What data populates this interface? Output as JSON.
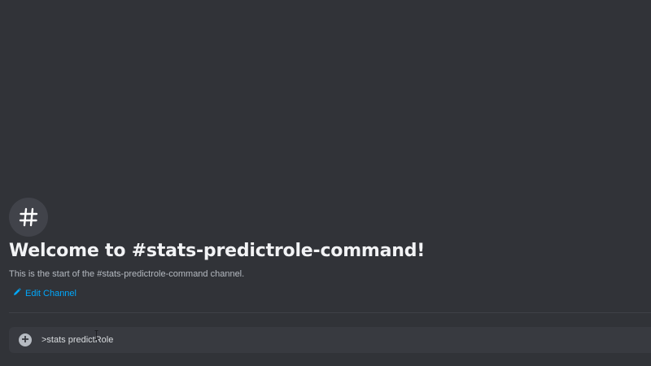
{
  "channel": {
    "name": "stats-predictrole-command",
    "icon": "hashtag-icon"
  },
  "welcome": {
    "title": "Welcome to #stats-predictrole-command!",
    "subtitle": "This is the start of the #stats-predictrole-command channel."
  },
  "actions": {
    "edit_channel_label": "Edit Channel",
    "edit_icon": "pencil-icon"
  },
  "composer": {
    "value": ">stats predictRole",
    "attach_icon": "plus-circle-icon"
  },
  "colors": {
    "background": "#313338",
    "composer_background": "#383a40",
    "link": "#00a8fc",
    "title": "#f2f3f5",
    "muted_text": "#b5bac1"
  }
}
